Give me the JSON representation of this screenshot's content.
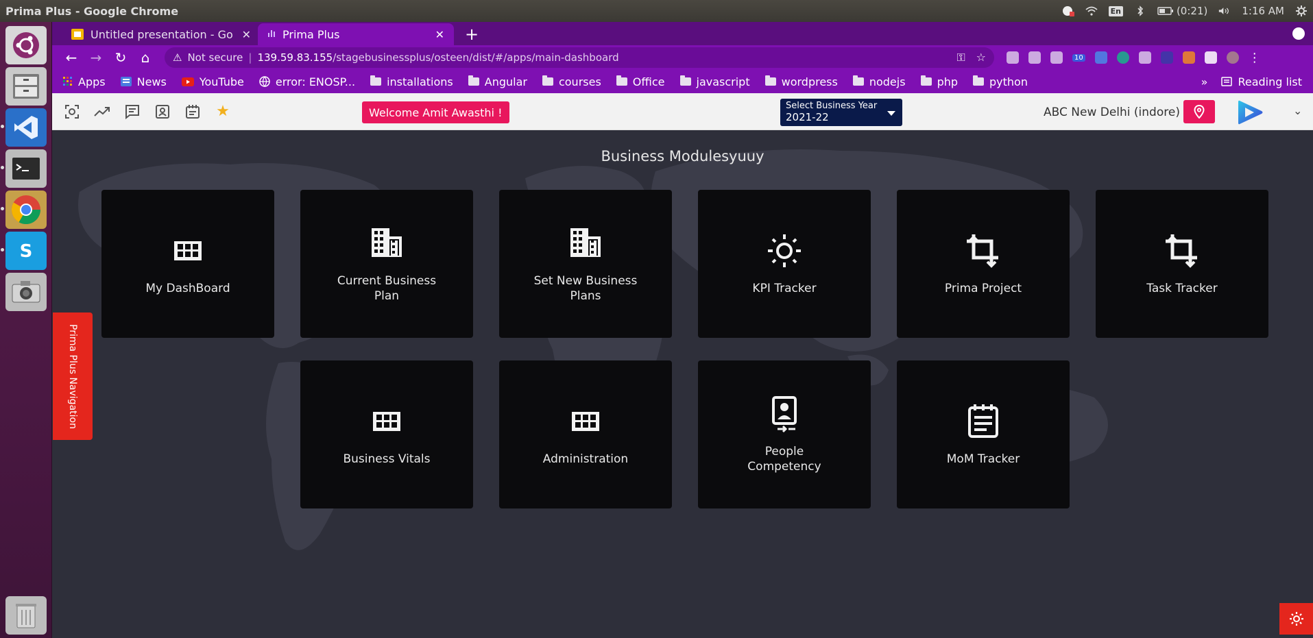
{
  "os": {
    "window_title": "Prima Plus - Google Chrome",
    "battery": "(0:21)",
    "clock": "1:16 AM",
    "keyboard": "En"
  },
  "browser": {
    "tabs": [
      {
        "label": "Untitled presentation - Go",
        "icon": "slides-icon"
      },
      {
        "label": "Prima Plus",
        "icon": "bar-chart-icon"
      }
    ],
    "url": {
      "security": "Not secure",
      "host": "139.59.83.155",
      "path": "/stagebusinessplus/osteen/dist/#/apps/main-dashboard"
    },
    "bookmarks": [
      {
        "label": "Apps",
        "icon": "apps-grid-icon"
      },
      {
        "label": "News",
        "icon": "news-icon"
      },
      {
        "label": "YouTube",
        "icon": "youtube-icon"
      },
      {
        "label": "error: ENOSP...",
        "icon": "globe-icon"
      },
      {
        "label": "installations",
        "icon": "folder-icon"
      },
      {
        "label": "Angular",
        "icon": "folder-icon"
      },
      {
        "label": "courses",
        "icon": "folder-icon"
      },
      {
        "label": "Office",
        "icon": "folder-icon"
      },
      {
        "label": "javascript",
        "icon": "folder-icon"
      },
      {
        "label": "wordpress",
        "icon": "folder-icon"
      },
      {
        "label": "nodejs",
        "icon": "folder-icon"
      },
      {
        "label": "php",
        "icon": "folder-icon"
      },
      {
        "label": "python",
        "icon": "folder-icon"
      }
    ],
    "overflow": "»",
    "reading_list": "Reading list",
    "ext_badge": "10"
  },
  "app": {
    "welcome": "Welcome  Amit Awasthi !",
    "year_label": "Select Business Year",
    "year_value": "2021-22",
    "location": "ABC New Delhi (indore)",
    "title": "Business Modulesyuuy",
    "side_nav": "Prima Plus Navigation",
    "modules": [
      {
        "label": "My DashBoard",
        "icon": "grid-icon"
      },
      {
        "label": "Current Business Plan",
        "icon": "building-icon"
      },
      {
        "label": "Set New Business Plans",
        "icon": "building-icon"
      },
      {
        "label": "KPI Tracker",
        "icon": "sun-icon"
      },
      {
        "label": "Prima Project",
        "icon": "crop-icon"
      },
      {
        "label": "Task Tracker",
        "icon": "crop-icon"
      },
      {
        "label": "Business Vitals",
        "icon": "grid-icon"
      },
      {
        "label": "Administration",
        "icon": "grid-icon"
      },
      {
        "label": "People Competency",
        "icon": "contact-badge-icon"
      },
      {
        "label": "MoM Tracker",
        "icon": "notepad-icon"
      }
    ]
  },
  "colors": {
    "chrome_purple": "#7e10b2",
    "accent_pink": "#e8175d",
    "accent_red": "#e4261d",
    "card_bg": "#0b0b0d",
    "year_bg": "#0a1a4a"
  }
}
